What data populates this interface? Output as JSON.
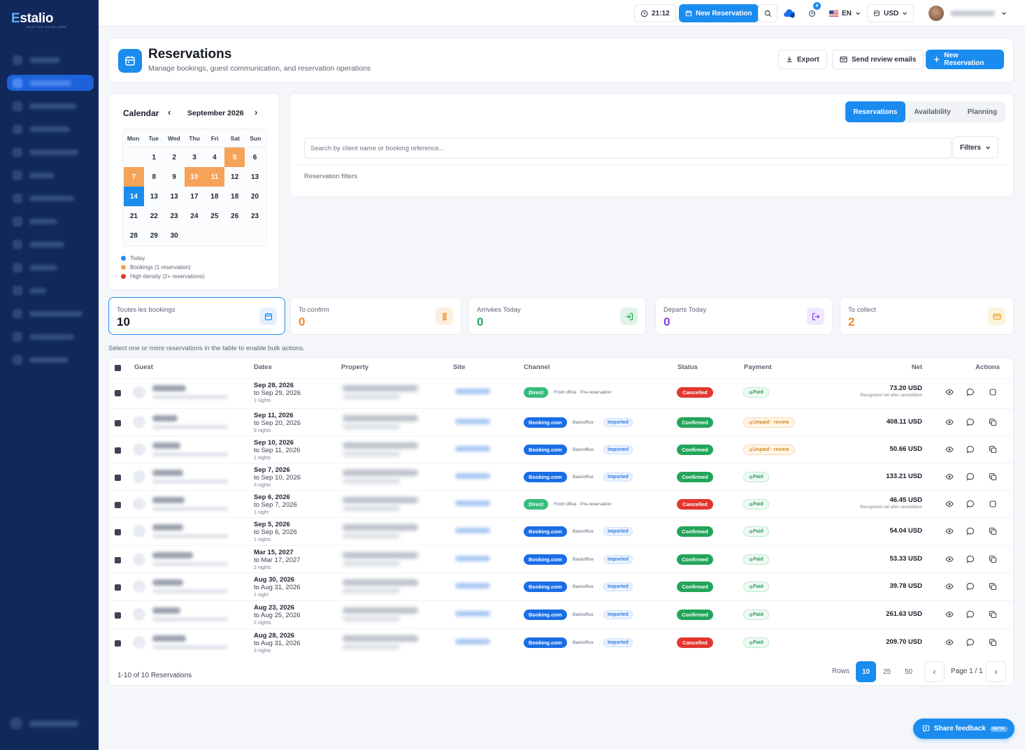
{
  "app": {
    "logo": "Estalio",
    "logo_initial": "E",
    "logo_rest": "stalio",
    "logo_sub": "GESTION HOTELIERE"
  },
  "colors": {
    "primary": "#1a8cf0",
    "sidebar": "#11295a",
    "booking_orange": "#f6a35a",
    "danger": "#e2362f",
    "success": "#22a55a"
  },
  "sidebar": {
    "item_count": 14,
    "active_index": 1
  },
  "topbar": {
    "time": "21:12",
    "new_reservation": "New Reservation",
    "notif_count": "6",
    "language": "EN",
    "currency": "USD"
  },
  "header": {
    "title": "Reservations",
    "subtitle": "Manage bookings, guest communication, and reservation operations",
    "export": "Export",
    "send_review": "Send review emails",
    "new_reservation": "New Reservation"
  },
  "calendar": {
    "title": "Calendar",
    "month": "September 2026",
    "weekdays": [
      "Mon",
      "Tue",
      "Wed",
      "Thu",
      "Fri",
      "Sat",
      "Sun"
    ],
    "days": [
      {
        "t": "",
        "s": ""
      },
      {
        "t": "1",
        "s": ""
      },
      {
        "t": "2",
        "s": ""
      },
      {
        "t": "3",
        "s": ""
      },
      {
        "t": "4",
        "s": ""
      },
      {
        "t": "5",
        "s": "booking"
      },
      {
        "t": "6",
        "s": ""
      },
      {
        "t": "7",
        "s": "booking"
      },
      {
        "t": "8",
        "s": ""
      },
      {
        "t": "9",
        "s": ""
      },
      {
        "t": "10",
        "s": "booking"
      },
      {
        "t": "11",
        "s": "booking"
      },
      {
        "t": "12",
        "s": ""
      },
      {
        "t": "13",
        "s": ""
      },
      {
        "t": "14",
        "s": "today"
      },
      {
        "t": "13",
        "s": ""
      },
      {
        "t": "13",
        "s": ""
      },
      {
        "t": "17",
        "s": ""
      },
      {
        "t": "18",
        "s": ""
      },
      {
        "t": "18",
        "s": ""
      },
      {
        "t": "20",
        "s": ""
      },
      {
        "t": "21",
        "s": ""
      },
      {
        "t": "22",
        "s": ""
      },
      {
        "t": "23",
        "s": ""
      },
      {
        "t": "24",
        "s": ""
      },
      {
        "t": "25",
        "s": ""
      },
      {
        "t": "26",
        "s": ""
      },
      {
        "t": "23",
        "s": ""
      },
      {
        "t": "28",
        "s": ""
      },
      {
        "t": "29",
        "s": ""
      },
      {
        "t": "30",
        "s": ""
      }
    ],
    "legend": [
      {
        "label": "Today",
        "color": "#1a8cf0"
      },
      {
        "label": "Bookings (1 reservation)",
        "color": "#f6a35a"
      },
      {
        "label": "High density (2+ reservations)",
        "color": "#e2362f"
      }
    ]
  },
  "search": {
    "tabs": [
      "Reservations",
      "Availability",
      "Planning"
    ],
    "placeholder": "Search by client name or booking reference...",
    "filters": "Filters",
    "filters_label": "Reservation filters"
  },
  "stats": [
    {
      "label": "Toutes les bookings",
      "value": "10",
      "color": "#161b27",
      "icon": "calendar-icon",
      "icon_bg": "#e6f0fd",
      "icon_color": "#1a8cf0"
    },
    {
      "label": "To confirm",
      "value": "0",
      "color": "#f08a2a",
      "icon": "hourglass-icon",
      "icon_bg": "#fdeee0",
      "icon_color": "#f08a2a"
    },
    {
      "label": "Arrivées Today",
      "value": "0",
      "color": "#22a55a",
      "icon": "login-icon",
      "icon_bg": "#e0f4e8",
      "icon_color": "#22a55a"
    },
    {
      "label": "Départs Today",
      "value": "0",
      "color": "#8a3de6",
      "icon": "logout-icon",
      "icon_bg": "#f1e8fd",
      "icon_color": "#8a3de6"
    },
    {
      "label": "To collect",
      "value": "2",
      "color": "#f08a2a",
      "icon": "card-icon",
      "icon_bg": "#fdf2dc",
      "icon_color": "#e8a21a"
    }
  ],
  "bulk_note": "Select one or more reservations in the table to enable bulk actions.",
  "table": {
    "headers": {
      "guest": "Guest",
      "dates": "Dates",
      "property": "Property",
      "site": "Site",
      "channel": "Channel",
      "status": "Status",
      "payment": "Payment",
      "net": "Net",
      "actions": "Actions"
    },
    "rows": [
      {
        "from": "Sep 28, 2026",
        "to": "to Sep 29, 2026",
        "nights": "1 nights",
        "channel": "Direct",
        "channel_type": "direct",
        "source": "Front office · Pre-reservation",
        "imported": "",
        "status": "Cancelled",
        "status_type": "cancelled",
        "payment": "Paid",
        "payment_type": "paid",
        "net": "73.20 USD",
        "net_note": "Recognized net after cancellation"
      },
      {
        "from": "Sep 11, 2026",
        "to": "to Sep 20, 2026",
        "nights": "9 nights",
        "channel": "Booking.com",
        "channel_type": "booking",
        "source": "Backoffice",
        "imported": "Imported",
        "status": "Confirmed",
        "status_type": "confirmed",
        "payment": "Unpaid · review",
        "payment_type": "unpaid",
        "net": "408.11 USD",
        "net_note": ""
      },
      {
        "from": "Sep 10, 2026",
        "to": "to Sep 11, 2026",
        "nights": "1 nights",
        "channel": "Booking.com",
        "channel_type": "booking",
        "source": "Backoffice",
        "imported": "Imported",
        "status": "Confirmed",
        "status_type": "confirmed",
        "payment": "Unpaid · review",
        "payment_type": "unpaid",
        "net": "50.66 USD",
        "net_note": ""
      },
      {
        "from": "Sep 7, 2026",
        "to": "to Sep 10, 2026",
        "nights": "3 nights",
        "channel": "Booking.com",
        "channel_type": "booking",
        "source": "Backoffice",
        "imported": "Imported",
        "status": "Confirmed",
        "status_type": "confirmed",
        "payment": "Paid",
        "payment_type": "paid",
        "net": "133.21 USD",
        "net_note": ""
      },
      {
        "from": "Sep 6, 2026",
        "to": "to Sep 7, 2026",
        "nights": "1 night",
        "channel": "Direct",
        "channel_type": "direct",
        "source": "Front office · Pre-reservation",
        "imported": "",
        "status": "Cancelled",
        "status_type": "cancelled",
        "payment": "Paid",
        "payment_type": "paid",
        "net": "46.45 USD",
        "net_note": "Recognized net after cancellation"
      },
      {
        "from": "Sep 5, 2026",
        "to": "to Sep 6, 2026",
        "nights": "1 nights",
        "channel": "Booking.com",
        "channel_type": "booking",
        "source": "Backoffice",
        "imported": "Imported",
        "status": "Confirmed",
        "status_type": "confirmed",
        "payment": "Paid",
        "payment_type": "paid",
        "net": "54.04 USD",
        "net_note": ""
      },
      {
        "from": "Mar 15, 2027",
        "to": "to Mar 17, 2027",
        "nights": "2 nights",
        "channel": "Booking.com",
        "channel_type": "booking",
        "source": "Backoffice",
        "imported": "Imported",
        "status": "Confirmed",
        "status_type": "confirmed",
        "payment": "Paid",
        "payment_type": "paid",
        "net": "53.33 USD",
        "net_note": ""
      },
      {
        "from": "Aug 30, 2026",
        "to": "to Aug 31, 2026",
        "nights": "1 night",
        "channel": "Booking.com",
        "channel_type": "booking",
        "source": "Backoffice",
        "imported": "Imported",
        "status": "Confirmed",
        "status_type": "confirmed",
        "payment": "Paid",
        "payment_type": "paid",
        "net": "39.78 USD",
        "net_note": ""
      },
      {
        "from": "Aug 23, 2026",
        "to": "to Aug 25, 2026",
        "nights": "2 nights",
        "channel": "Booking.com",
        "channel_type": "booking",
        "source": "Backoffice",
        "imported": "Imported",
        "status": "Confirmed",
        "status_type": "confirmed",
        "payment": "Paid",
        "payment_type": "paid",
        "net": "261.63 USD",
        "net_note": ""
      },
      {
        "from": "Aug 28, 2026",
        "to": "to Aug 31, 2026",
        "nights": "3 nights",
        "channel": "Booking.com",
        "channel_type": "booking",
        "source": "Backoffice",
        "imported": "Imported",
        "status": "Cancelled",
        "status_type": "cancelled",
        "payment": "Paid",
        "payment_type": "paid",
        "net": "209.70 USD",
        "net_note": ""
      }
    ],
    "row_actions": [
      "eye-icon",
      "chat-icon",
      "copy-icon"
    ]
  },
  "pagination": {
    "summary": "1-10 of 10 Reservations",
    "rows_label": "Rows",
    "sizes": [
      "10",
      "25",
      "50"
    ],
    "active_size": "10",
    "page": "Page 1 / 1"
  },
  "feedback": {
    "label": "Share feedback",
    "badge": "BETA"
  }
}
